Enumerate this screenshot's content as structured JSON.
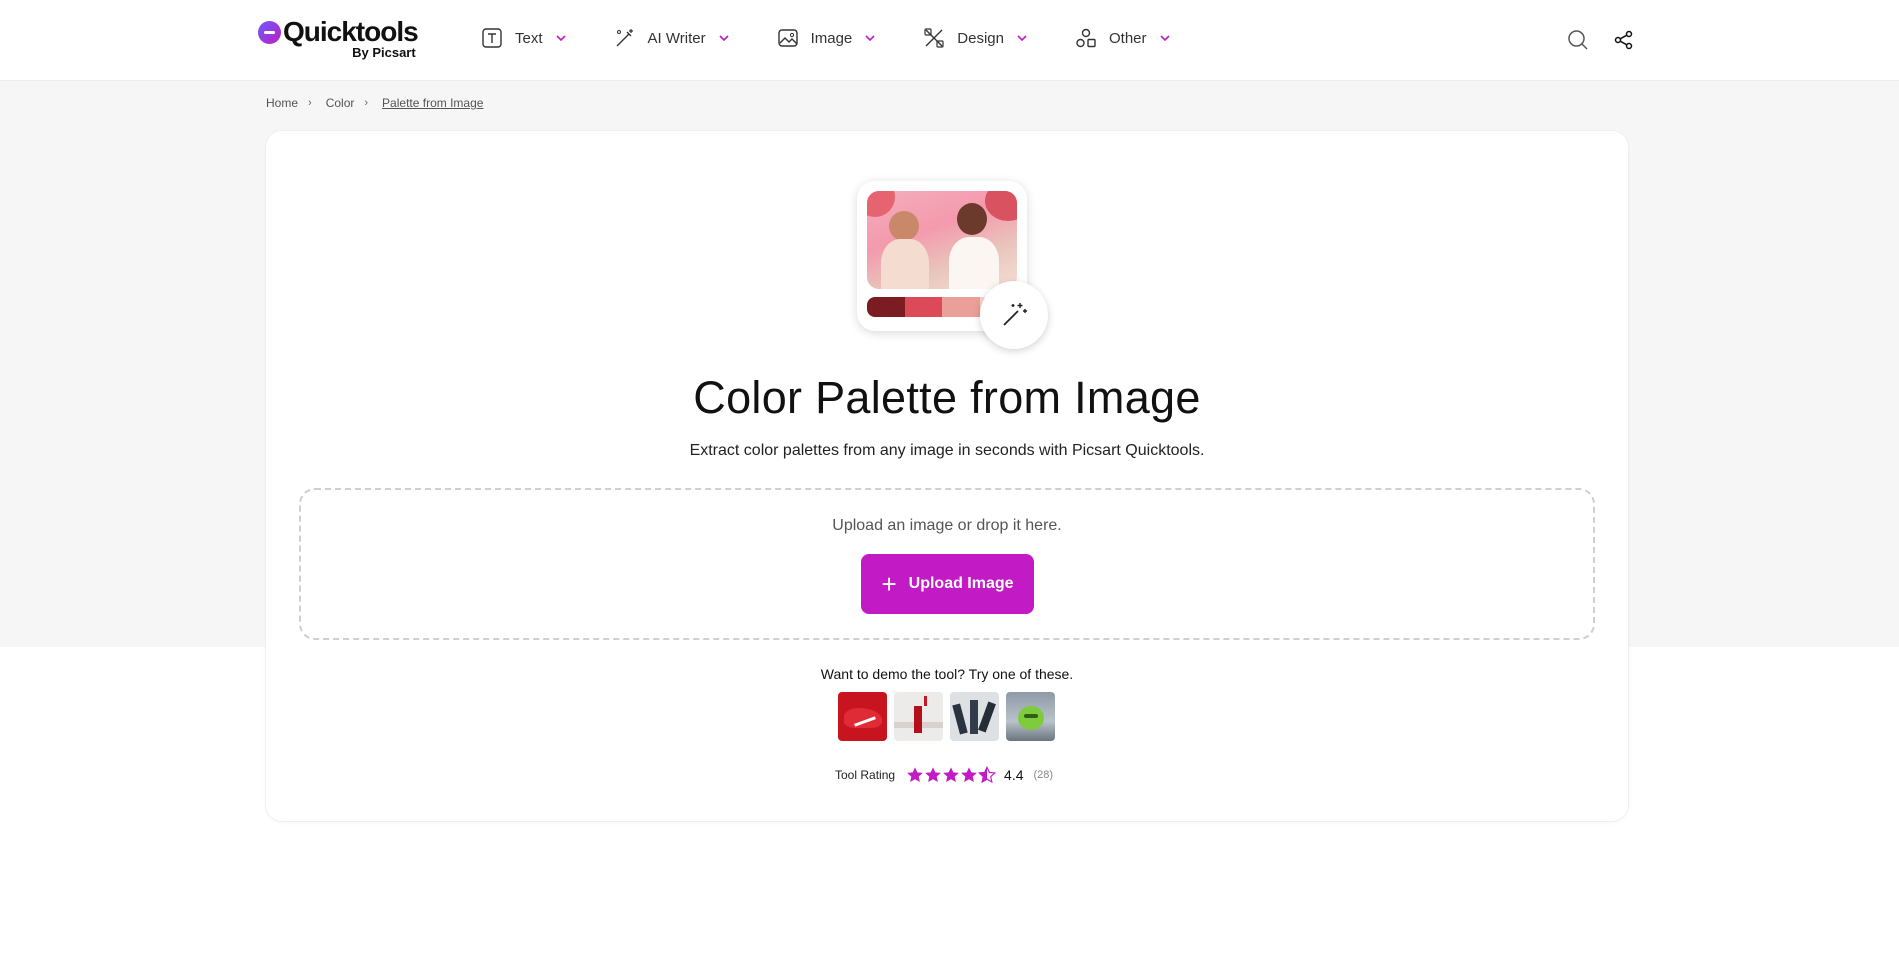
{
  "brand": {
    "name": "Quicktools",
    "sub": "By Picsart"
  },
  "nav": {
    "items": [
      {
        "label": "Text",
        "icon": "text-icon"
      },
      {
        "label": "AI Writer",
        "icon": "ai-writer-icon"
      },
      {
        "label": "Image",
        "icon": "image-icon"
      },
      {
        "label": "Design",
        "icon": "design-icon"
      },
      {
        "label": "Other",
        "icon": "other-icon"
      }
    ],
    "actions": [
      "search-icon",
      "share-icon"
    ]
  },
  "breadcrumb": {
    "home": "Home",
    "section": "Color",
    "current": "Palette from Image"
  },
  "hero": {
    "palette": [
      "#7a1c22",
      "#dc4a5a",
      "#eaa098",
      "#f6d6cc"
    ]
  },
  "page": {
    "title": "Color Palette from Image",
    "subtitle": "Extract color palettes from any image in seconds with Picsart Quicktools."
  },
  "upload": {
    "hint": "Upload an image or drop it here.",
    "button": "Upload Image"
  },
  "demo": {
    "label": "Want to demo the tool? Try one of these.",
    "samples": [
      "red-sneaker",
      "lipstick",
      "dancers",
      "green-apple"
    ]
  },
  "rating": {
    "label": "Tool Rating",
    "value": "4.4",
    "stars": 4.4,
    "count": "(28)"
  },
  "colors": {
    "accent": "#c21bc6",
    "band": "#f6f6f6"
  }
}
